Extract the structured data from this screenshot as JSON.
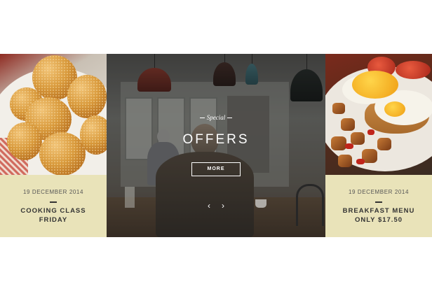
{
  "cards": [
    {
      "date": "19 DECEMBER 2014",
      "title_line1": "COOKING CLASS",
      "title_line2": "FRIDAY",
      "bg_color": "#e9e3b9"
    },
    {
      "date": "19 DECEMBER 2014",
      "title_line1": "BREAKFAST MENU",
      "title_line2": "ONLY $17.50",
      "bg_color": "#e9e3b9"
    }
  ],
  "hero": {
    "kicker": "Special",
    "title": "OFFERS",
    "button_label": "MORE",
    "prev_icon": "‹",
    "next_icon": "›"
  }
}
